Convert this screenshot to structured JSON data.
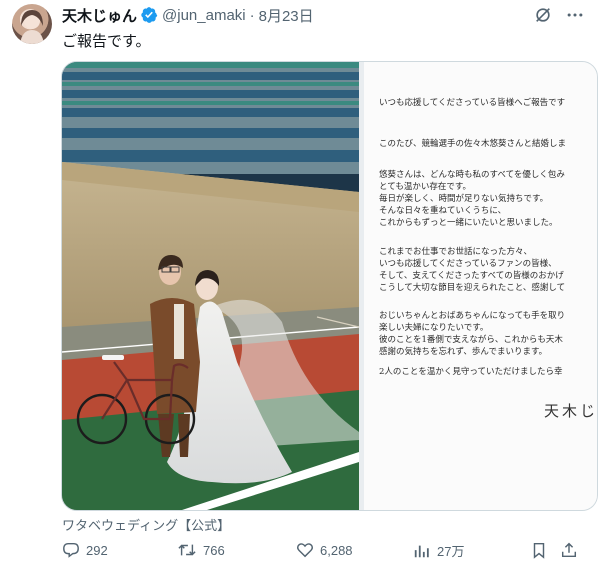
{
  "tweet": {
    "display_name": "天木じゅん",
    "handle": "@jun_amaki",
    "separator": "·",
    "date": "8月23日",
    "text": "ご報告です。"
  },
  "letter": {
    "lines": [
      "いつも応援してくださっている皆様へご報告です",
      "このたび、競輪選手の佐々木悠葵さんと結婚しま",
      "悠葵さんは、どんな時も私のすべてを優しく包み",
      "とても温かい存在です。",
      "毎日が楽しく、時間が足りない気持ちです。",
      "そんな日々を重ねていくうちに、",
      "これからもずっと一緒にいたいと思いました。",
      "これまでお仕事でお世話になった方々、",
      "いつも応援してくださっているファンの皆様、",
      "そして、支えてくださったすべての皆様のおかげ",
      "こうして大切な節目を迎えられたこと、感謝して",
      "おじいちゃんとおばあちゃんになっても手を取り",
      "楽しい夫婦になりたいです。",
      "彼のことを1番側で支えながら、これからも天木",
      "感謝の気持ちを忘れず、歩んでまいります。",
      "2人のことを温かく見守っていただけましたら幸"
    ],
    "signature": "天木じ"
  },
  "credit": "ワタベウェディング【公式】",
  "stats": {
    "replies": "292",
    "reposts": "766",
    "likes": "6,288",
    "views": "27万"
  },
  "colors": {
    "text_primary": "#0f1419",
    "text_secondary": "#536471",
    "verified": "#1d9bf0",
    "border": "#cfd9de"
  }
}
